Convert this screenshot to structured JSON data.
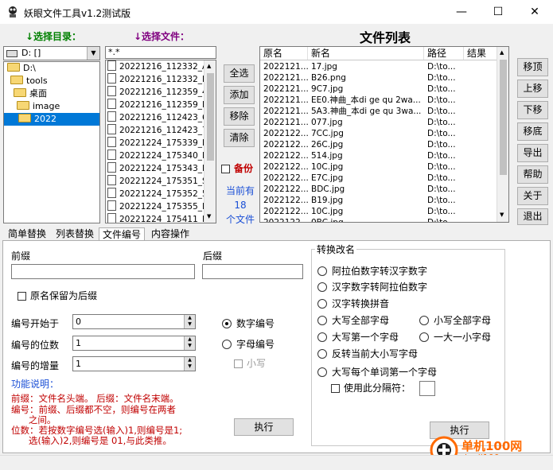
{
  "window": {
    "title": "妖眼文件工具v1.2测试版",
    "min_glyph": "—",
    "max_glyph": "☐",
    "close_glyph": "✕"
  },
  "left": {
    "dir_label": "↓选择目录：",
    "file_label": "↓选择文件：",
    "drive_value": "D: []",
    "tree": [
      {
        "name": "D:\\",
        "level": 0,
        "open": true
      },
      {
        "name": "tools",
        "level": 1,
        "open": true
      },
      {
        "name": "桌面",
        "level": 2,
        "open": true
      },
      {
        "name": "image",
        "level": 3,
        "open": true
      },
      {
        "name": "2022",
        "level": 4,
        "open": true,
        "selected": true
      }
    ],
    "filter_value": "*.*",
    "files": [
      "20221216_112332_A",
      "20221216_112332_D",
      "20221216_112359_4",
      "20221216_112359_E",
      "20221216_112423_6",
      "20221216_112423_7",
      "20221224_175339_E",
      "20221224_175340_E",
      "20221224_175343_E",
      "20221224_175351_S",
      "20221224_175352_5",
      "20221224_175355_D",
      "20221224_175411_F"
    ]
  },
  "mid_buttons": {
    "select_all": "全选",
    "add": "添加",
    "remove": "移除",
    "clear": "清除",
    "backup": "备份",
    "current_prefix": "当前有",
    "current_count": "18",
    "current_suffix": "个文件"
  },
  "file_list": {
    "title": "文件列表",
    "columns": [
      "原名",
      "新名",
      "路径",
      "结果"
    ],
    "rows": [
      [
        "2022121...",
        "17.jpg",
        "D:\\to..."
      ],
      [
        "2022121...",
        "B26.png",
        "D:\\to..."
      ],
      [
        "2022121...",
        "9C7.jpg",
        "D:\\to..."
      ],
      [
        "2022121...",
        "EE0.神曲_本di ge qu 2wa...",
        "D:\\to..."
      ],
      [
        "2022121...",
        "5A3.神曲_本di ge qu 3wa...",
        "D:\\to..."
      ],
      [
        "2022121...",
        "077.jpg",
        "D:\\to..."
      ],
      [
        "2022122...",
        "7CC.jpg",
        "D:\\to..."
      ],
      [
        "2022122...",
        "26C.jpg",
        "D:\\to..."
      ],
      [
        "2022122...",
        "514.jpg",
        "D:\\to..."
      ],
      [
        "2022122...",
        "10C.jpg",
        "D:\\to..."
      ],
      [
        "2022122...",
        "E7C.jpg",
        "D:\\to..."
      ],
      [
        "2022122...",
        "BDC.jpg",
        "D:\\to..."
      ],
      [
        "2022122...",
        "B19.jpg",
        "D:\\to..."
      ],
      [
        "2022122...",
        "10C.jpg",
        "D:\\to..."
      ],
      [
        "2022122...",
        "0BC.jpg",
        "D:\\to..."
      ]
    ]
  },
  "right_buttons": {
    "move_top": "移顶",
    "move_up": "上移",
    "move_down": "下移",
    "move_bottom": "移底",
    "export": "导出",
    "help": "帮助",
    "about": "关于",
    "exit": "退出"
  },
  "tabs": [
    "简单替换",
    "列表替换",
    "文件编号",
    "内容操作"
  ],
  "active_tab_index": 2,
  "numbering": {
    "prefix_label": "前缀",
    "suffix_label": "后缀",
    "prefix_value": "",
    "suffix_value": "",
    "keep_name_label": "原名保留为后缀",
    "start_label": "编号开始于",
    "start_value": "0",
    "digits_label": "编号的位数",
    "digits_value": "1",
    "increment_label": "编号的增量",
    "increment_value": "1",
    "mode_digit": "数字编号",
    "mode_letter": "字母编号",
    "lowercase": "小写",
    "help_title": "功能说明：",
    "help_lines": [
      "前缀：文件名头端。  后缀：文件名末端。",
      "编号：前缀、后缀都不空，则编号在两者",
      "      之间。",
      "位数：若按数字编号选(输入)1,则编号是1;",
      "      选(输入)2,则编号是 01,与此类推。"
    ],
    "execute": "执行"
  },
  "convert": {
    "group_title": "转换改名",
    "opt_arabic_to_cn": "阿拉伯数字转汉字数字",
    "opt_cn_to_arabic": "汉字数字转阿拉伯数字",
    "opt_pinyin": "汉字转换拼音",
    "opt_upper_all": "大写全部字母",
    "opt_lower_all": "小写全部字母",
    "opt_upper_first": "大写第一个字母",
    "opt_lower_first": "一大一小字母",
    "opt_invert": "反转当前大小写字母",
    "opt_upper_each_word": "大写每个单词第一个字母",
    "use_separator": "使用此分隔符：",
    "separator_value": "",
    "execute": "执行"
  },
  "watermark": {
    "brand": "单机100网",
    "url": "danji100.com"
  }
}
